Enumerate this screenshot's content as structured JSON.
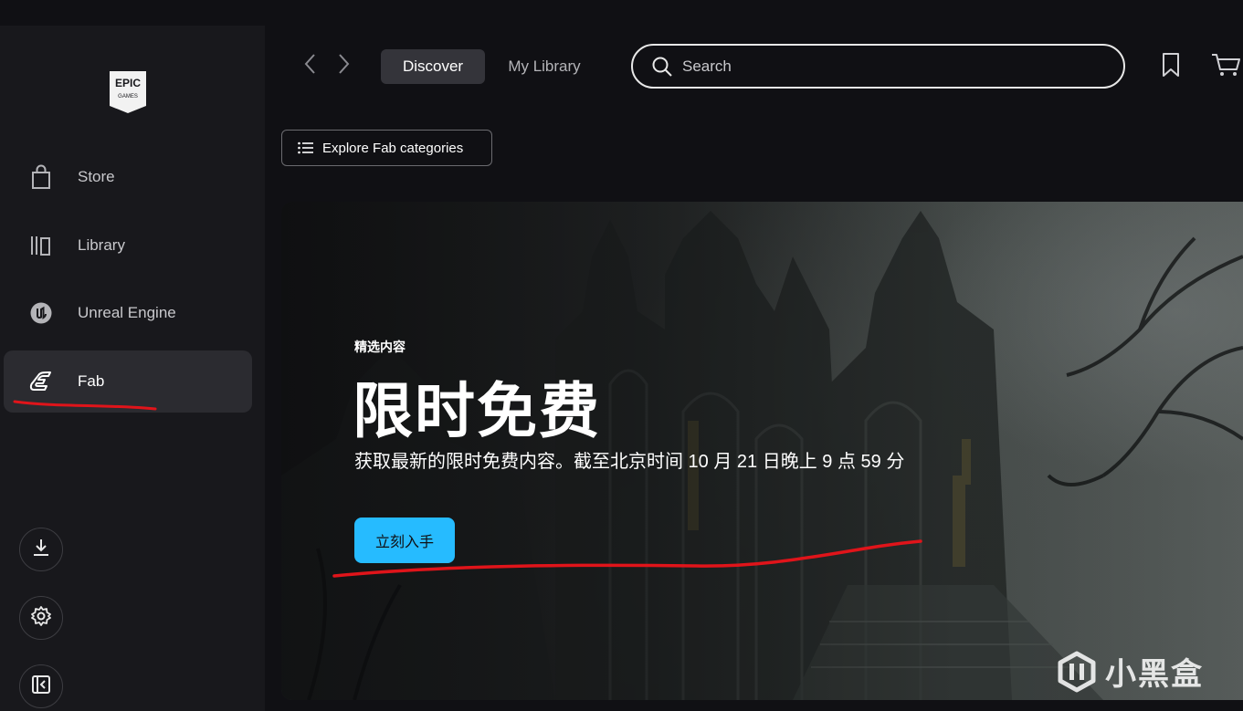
{
  "sidebar": {
    "logo_text_top": "EPIC",
    "logo_text_bottom": "GAMES",
    "items": [
      {
        "label": "Store",
        "icon": "shopping-bag-icon"
      },
      {
        "label": "Library",
        "icon": "library-icon"
      },
      {
        "label": "Unreal Engine",
        "icon": "unreal-engine-icon"
      },
      {
        "label": "Fab",
        "icon": "fab-icon",
        "active": true
      }
    ],
    "bottom_buttons": [
      "download-icon",
      "gear-icon",
      "collapse-sidebar-icon"
    ]
  },
  "header": {
    "tabs": [
      {
        "label": "Discover",
        "active": true
      },
      {
        "label": "My Library",
        "active": false
      }
    ],
    "search": {
      "placeholder": "Search",
      "value": ""
    },
    "icons": [
      "bookmark-icon",
      "cart-icon"
    ]
  },
  "explore": {
    "label": "Explore Fab categories"
  },
  "hero": {
    "eyebrow": "精选内容",
    "title": "限时免费",
    "subtitle": "获取最新的限时免费内容。截至北京时间 10 月 21 日晚上 9 点 59 分",
    "cta_label": "立刻入手",
    "watermark": "小黑盒"
  },
  "colors": {
    "accent": "#26bbff",
    "sidebar_bg": "#18181c",
    "page_bg": "#101014",
    "annotation": "#e0141a"
  }
}
